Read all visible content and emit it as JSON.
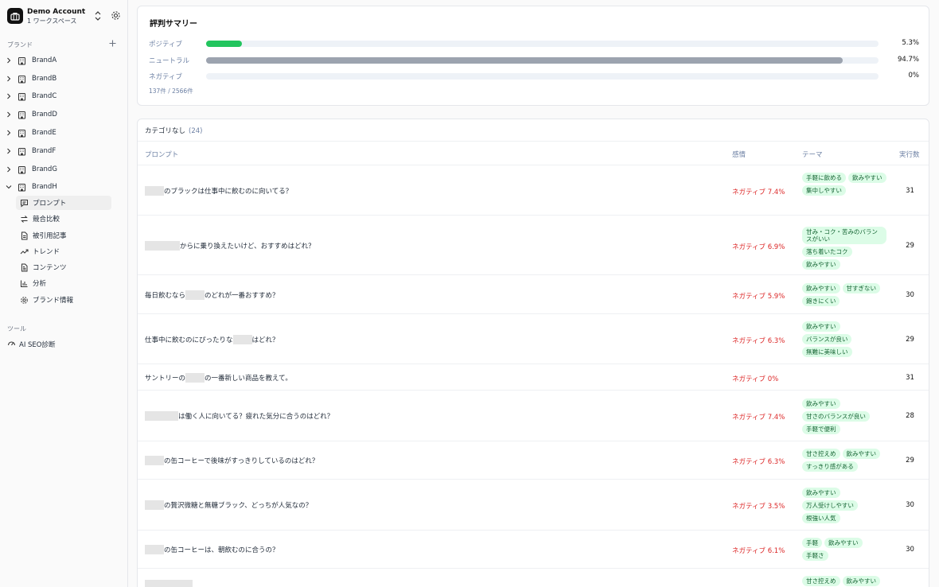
{
  "account": {
    "name": "Demo Account",
    "workspaces": "1 ワークスペース"
  },
  "sidebar": {
    "brands_label": "ブランド",
    "brands": [
      "BrandA",
      "BrandB",
      "BrandC",
      "BrandD",
      "BrandE",
      "BrandF",
      "BrandG",
      "BrandH"
    ],
    "brand_sub": [
      {
        "label": "プロンプト",
        "icon": "message-square-icon"
      },
      {
        "label": "競合比較",
        "icon": "swap-icon"
      },
      {
        "label": "被引用記事",
        "icon": "document-icon"
      },
      {
        "label": "トレンド",
        "icon": "trend-icon"
      },
      {
        "label": "コンテンツ",
        "icon": "file-text-icon"
      },
      {
        "label": "分析",
        "icon": "bar-chart-icon"
      },
      {
        "label": "ブランド情報",
        "icon": "gear-icon"
      }
    ],
    "tools_label": "ツール",
    "tools": [
      {
        "label": "AI SEO診断",
        "icon": "gauge-icon"
      }
    ]
  },
  "summary": {
    "title": "評判サマリー",
    "rows": [
      {
        "label": "ポジティブ",
        "value": 5.3,
        "display": "5.3%",
        "color": "#22c55e"
      },
      {
        "label": "ニュートラル",
        "value": 94.7,
        "display": "94.7%",
        "color": "#9ca3af"
      },
      {
        "label": "ネガティブ",
        "value": 0,
        "display": "0%",
        "color": "#ef4444"
      }
    ],
    "count": "137件 / 2566件"
  },
  "table": {
    "category": "カテゴリなし",
    "category_count": "(24)",
    "headers": {
      "prompt": "プロンプト",
      "sentiment": "感情",
      "theme": "テーマ",
      "runs": "実行数"
    },
    "rows": [
      {
        "prompt": [
          "",
          "のブラックは仕事中に飲むのに向いてる？"
        ],
        "sentiment": "ネガティブ 7.4%",
        "themes": [
          "手軽に飲める",
          "飲みやすい",
          "集中しやすい"
        ],
        "runs": "31"
      },
      {
        "prompt": [
          "",
          "から",
          "に乗り換えたいけど、おすすめはどれ？"
        ],
        "sentiment": "ネガティブ 6.9%",
        "themes": [
          "甘み・コク・苦みのバランスがいい",
          "落ち着いたコク",
          "飲みやすい"
        ],
        "runs": "29"
      },
      {
        "prompt": [
          "毎日飲むなら",
          "",
          "のどれが一番おすすめ？"
        ],
        "sentiment": "ネガティブ 5.9%",
        "themes": [
          "飲みやすい",
          "甘すぎない",
          "飽きにくい"
        ],
        "runs": "30"
      },
      {
        "prompt": [
          "仕事中に飲むのにぴったりな",
          "",
          "はどれ？"
        ],
        "sentiment": "ネガティブ 6.3%",
        "themes": [
          "飲みやすい",
          "バランスが良い",
          "無難に美味しい"
        ],
        "runs": "29"
      },
      {
        "prompt": [
          "サントリーの",
          "",
          "の一番新しい商品を教えて。"
        ],
        "sentiment": "ネガティブ 0%",
        "themes": [],
        "runs": "31"
      },
      {
        "prompt": [
          "",
          "は働く人に向いてる？疲れた気分に合うのはどれ？"
        ],
        "sentiment": "ネガティブ 7.4%",
        "themes": [
          "飲みやすい",
          "甘さのバランスが良い",
          "手軽で便利"
        ],
        "runs": "28"
      },
      {
        "prompt": [
          "",
          "の缶コーヒーで後味がすっきりしているのはどれ？"
        ],
        "sentiment": "ネガティブ 6.3%",
        "themes": [
          "甘さ控えめ",
          "飲みやすい",
          "すっきり感がある"
        ],
        "runs": "29"
      },
      {
        "prompt": [
          "",
          "の贅沢微糖と無糖ブラック、どっちが人気なの？"
        ],
        "sentiment": "ネガティブ 3.5%",
        "themes": [
          "飲みやすい",
          "万人受けしやすい",
          "根強い人気"
        ],
        "runs": "30"
      },
      {
        "prompt": [
          "",
          "の缶コーヒーは、朝飲むのに合うの？"
        ],
        "sentiment": "ネガティブ 6.1%",
        "themes": [
          "手軽",
          "飲みやすい",
          "手軽さ"
        ],
        "runs": "30"
      },
      {
        "prompt": [
          ""
        ],
        "sentiment": "",
        "themes": [
          "甘さ控えめ",
          "飲みやすい"
        ],
        "runs": ""
      }
    ]
  }
}
